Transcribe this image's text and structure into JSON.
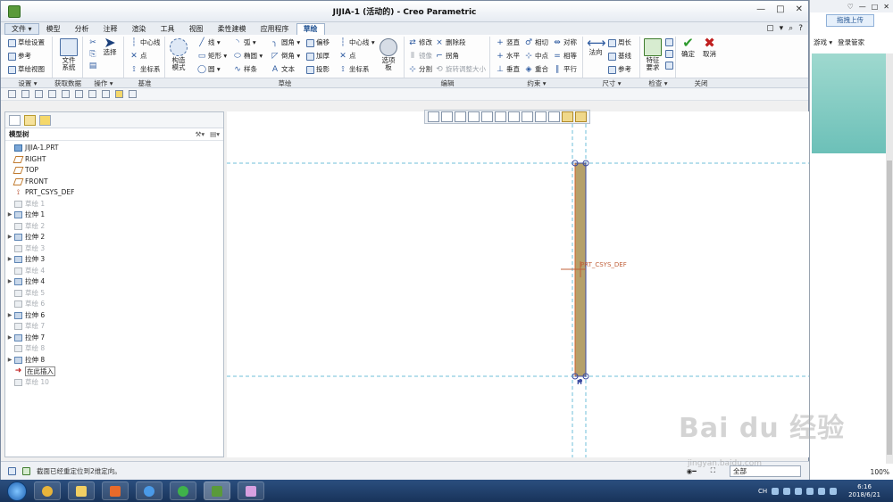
{
  "window": {
    "title": "JIJIA-1 (活动的) - Creo Parametric",
    "controls": [
      "—",
      "□",
      "✕"
    ]
  },
  "menu_tabs": [
    {
      "label": "文件 ▾",
      "kind": "file"
    },
    {
      "label": "模型"
    },
    {
      "label": "分析"
    },
    {
      "label": "注释"
    },
    {
      "label": "渲染"
    },
    {
      "label": "工具"
    },
    {
      "label": "视图"
    },
    {
      "label": "柔性建模"
    },
    {
      "label": "应用程序"
    },
    {
      "label": "草绘",
      "kind": "active"
    }
  ],
  "tab_right_controls": [
    "▢",
    "▾",
    "⌕",
    "?"
  ],
  "ribbon": {
    "settings": [
      "草绘设置",
      "参考",
      "草绘视图"
    ],
    "getdata": "文件系统",
    "operations_label": "选择",
    "datum": [
      "中心线",
      "点",
      "坐标系"
    ],
    "construction_mode": "构造模式",
    "sketch_col1": [
      "线 ▾",
      "矩形 ▾",
      "圆 ▾"
    ],
    "sketch_col2": [
      "弧 ▾",
      "椭圆 ▾",
      "样条"
    ],
    "sketch_col3": [
      "圆角 ▾",
      "倒角 ▾",
      "文本"
    ],
    "sketch_col4": [
      "偏移",
      "加厚",
      "投影"
    ],
    "sketch_col5": [
      "中心线 ▾",
      "点",
      "坐标系"
    ],
    "palette": "选项板",
    "edit_col1": [
      "修改",
      "镜像",
      "分割"
    ],
    "edit_col2": [
      "删除段",
      "拐角",
      "旋转调整大小"
    ],
    "constraint_col1": [
      "竖直",
      "水平",
      "垂直"
    ],
    "constraint_col2": [
      "相切",
      "中点",
      "重合"
    ],
    "constraint_col3": [
      "对称",
      "相等",
      "平行"
    ],
    "dimension_main": "法向",
    "dimension_col": [
      "周长",
      "基线",
      "参考"
    ],
    "inspect_main": "特征要求",
    "close_ok": "确定",
    "close_cancel": "取消",
    "group_labels": [
      "设置 ▾",
      "获取数据",
      "操作 ▾",
      "基准",
      "草绘",
      "编辑",
      "约束 ▾",
      "尺寸 ▾",
      "检查 ▾",
      "关闭"
    ]
  },
  "model_tree": {
    "header": "模型树",
    "nodes": [
      {
        "label": "JIJIA-1.PRT",
        "icon": "part",
        "expand": ""
      },
      {
        "label": "RIGHT",
        "icon": "plane",
        "expand": ""
      },
      {
        "label": "TOP",
        "icon": "plane",
        "expand": ""
      },
      {
        "label": "FRONT",
        "icon": "plane",
        "expand": ""
      },
      {
        "label": "PRT_CSYS_DEF",
        "icon": "csys",
        "expand": ""
      },
      {
        "label": "草绘 1",
        "icon": "sketch",
        "dim": true,
        "expand": ""
      },
      {
        "label": "拉伸 1",
        "icon": "extrude",
        "expand": "▶"
      },
      {
        "label": "草绘 2",
        "icon": "sketch",
        "dim": true,
        "expand": ""
      },
      {
        "label": "拉伸 2",
        "icon": "extrude",
        "expand": "▶"
      },
      {
        "label": "草绘 3",
        "icon": "sketch",
        "dim": true,
        "expand": ""
      },
      {
        "label": "拉伸 3",
        "icon": "extrude",
        "expand": "▶"
      },
      {
        "label": "草绘 4",
        "icon": "sketch",
        "dim": true,
        "expand": ""
      },
      {
        "label": "拉伸 4",
        "icon": "extrude",
        "expand": "▶"
      },
      {
        "label": "草绘 5",
        "icon": "sketch",
        "dim": true,
        "expand": ""
      },
      {
        "label": "草绘 6",
        "icon": "sketch",
        "dim": true,
        "expand": ""
      },
      {
        "label": "拉伸 6",
        "icon": "extrude",
        "expand": "▶"
      },
      {
        "label": "草绘 7",
        "icon": "sketch",
        "dim": true,
        "expand": ""
      },
      {
        "label": "拉伸 7",
        "icon": "extrude",
        "expand": "▶"
      },
      {
        "label": "草绘 8",
        "icon": "sketch",
        "dim": true,
        "expand": ""
      },
      {
        "label": "拉伸 8",
        "icon": "extrude",
        "expand": "▶"
      },
      {
        "label": "在此插入",
        "icon": "insert",
        "expand": ""
      },
      {
        "label": "草绘 10",
        "icon": "sketch",
        "dim": true,
        "expand": ""
      }
    ]
  },
  "graphics": {
    "csys_label": "PRT_CSYS_DEF",
    "h_marker": "H"
  },
  "status": {
    "message": "截面已经重定位到2维定向。",
    "filter": "全部"
  },
  "browser": {
    "upload": "拖拽上传",
    "links": [
      "游戏 ▾",
      "登录管家"
    ],
    "top_icons": [
      "♡",
      "—",
      "□",
      "✕"
    ],
    "zoom": "100%"
  },
  "taskbar": {
    "tray_lang": "CH",
    "time": "6:16",
    "date": "2018/6/21"
  },
  "watermark": {
    "brand": "Bai du 经验",
    "url": "jingyan.baidu.com"
  },
  "colors": {
    "sketch_fill": "#b5a06a",
    "sketch_stroke": "#3a4aa0",
    "ref_line": "#6fbfd8",
    "ok": "#2e9a2e",
    "cancel": "#c02020"
  }
}
